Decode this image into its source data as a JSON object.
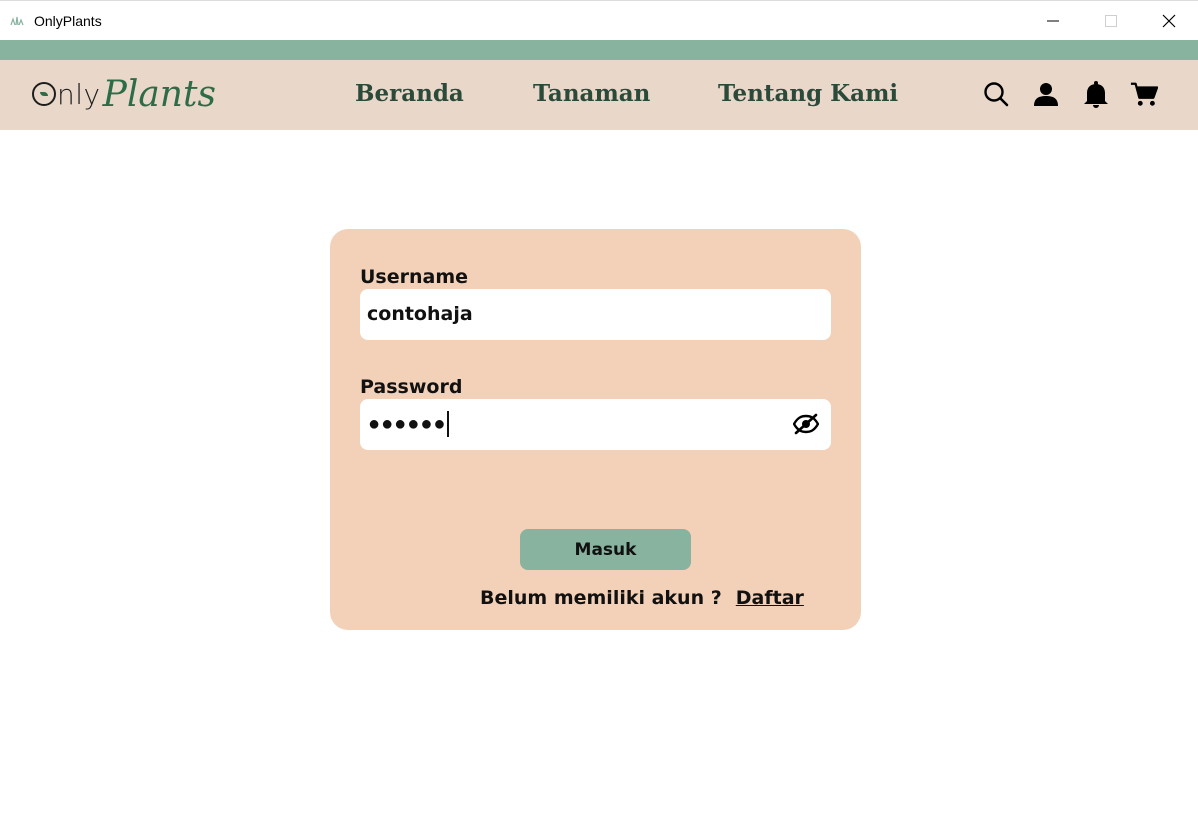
{
  "window": {
    "title": "OnlyPlants"
  },
  "header": {
    "logo_only": "nly",
    "logo_plants": "Plants",
    "nav": [
      "Beranda",
      "Tanaman",
      "Tentang Kami"
    ]
  },
  "login": {
    "username_label": "Username",
    "username_value": "contohaja",
    "password_label": "Password",
    "password_mask": "●●●●●●",
    "submit_label": "Masuk",
    "register_prompt": "Belum memiliki akun ?",
    "register_link": "Daftar"
  },
  "icons": [
    "app-icon",
    "minimize-icon",
    "maximize-icon",
    "close-icon",
    "search-icon",
    "user-icon",
    "bell-icon",
    "cart-icon",
    "eye-off-icon"
  ],
  "colors": {
    "accent": "#87b39f",
    "header_bg": "#e9d8ca",
    "card_bg": "#f3d1b9",
    "brand_green": "#2e6b47"
  }
}
